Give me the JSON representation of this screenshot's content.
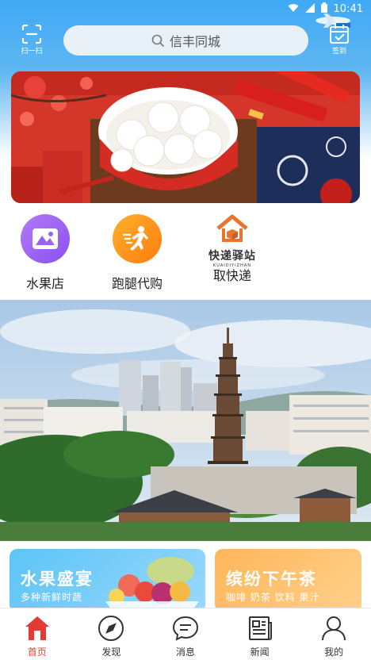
{
  "status_bar": {
    "time": "10:41"
  },
  "header": {
    "scan_label": "扫一扫",
    "search_text": "信丰同城",
    "signin_label": "签到"
  },
  "entries": [
    {
      "label": "水果店",
      "icon": "fruit-shop-icon"
    },
    {
      "label": "跑腿代购",
      "icon": "errand-runner-icon"
    },
    {
      "label": "取快递",
      "icon": "express-station-icon",
      "logo_cn": "快递驿站",
      "logo_py": "KUAIDIYIZHAN"
    }
  ],
  "promos": [
    {
      "title": "水果盛宴",
      "subtitle": "多种新鲜时蔬"
    },
    {
      "title": "缤纷下午茶",
      "subtitle": "咖啡 奶茶 饮料 果汁"
    }
  ],
  "tabs": [
    {
      "label": "首页",
      "icon": "home-icon",
      "active": true
    },
    {
      "label": "发现",
      "icon": "compass-icon",
      "active": false
    },
    {
      "label": "消息",
      "icon": "message-icon",
      "active": false
    },
    {
      "label": "新闻",
      "icon": "news-icon",
      "active": false
    },
    {
      "label": "我的",
      "icon": "profile-icon",
      "active": false
    }
  ],
  "colors": {
    "header_blue": "#3fa9f5",
    "active_red": "#e53935",
    "fruit_purple": "#8a4ff0",
    "errand_orange": "#ff7b10",
    "express_orange": "#e8752b"
  }
}
